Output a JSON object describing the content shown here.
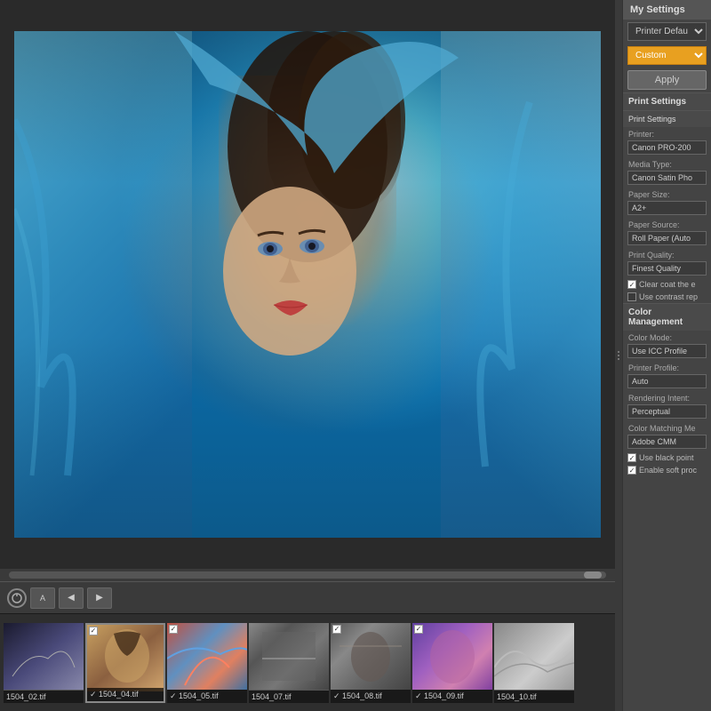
{
  "panel": {
    "my_settings_label": "My Settings",
    "printer_default_label": "Printer Default",
    "custom_label": "Custom",
    "apply_label": "Apply",
    "print_settings_header": "Print Settings",
    "print_settings_sub": "Print Settings",
    "printer_field_label": "Printer:",
    "printer_field_value": "Canon PRO-200",
    "media_type_label": "Media Type:",
    "media_type_value": "Canon Satin Pho",
    "paper_size_label": "Paper Size:",
    "paper_size_value": "A2+",
    "paper_source_label": "Paper Source:",
    "paper_source_value": "Roll Paper (Auto",
    "print_quality_label": "Print Quality:",
    "print_quality_value": "Finest Quality",
    "clear_coat_label": "Clear coat the e",
    "use_contrast_label": "Use contrast rep",
    "color_management_label": "Color Management",
    "color_mode_label": "Color Mode:",
    "color_mode_value": "Use ICC Profile",
    "printer_profile_label": "Printer Profile:",
    "printer_profile_value": "Auto",
    "rendering_intent_label": "Rendering Intent:",
    "rendering_intent_value": "Perceptual",
    "color_matching_label": "Color Matching Me",
    "color_matching_value": "Adobe CMM",
    "use_black_point_label": "Use black point",
    "enable_soft_label": "Enable soft proc"
  },
  "filmstrip": {
    "items": [
      {
        "filename": "1504_02.tif",
        "checked": false
      },
      {
        "filename": "1504_04.tif",
        "checked": true
      },
      {
        "filename": "1504_05.tif",
        "checked": true
      },
      {
        "filename": "1504_07.tif",
        "checked": false
      },
      {
        "filename": "1504_08.tif",
        "checked": true
      },
      {
        "filename": "1504_09.tif",
        "checked": true
      },
      {
        "filename": "1504_10.tif",
        "checked": false
      }
    ]
  },
  "toolbar": {
    "rotate_label": "⟳",
    "back_label": "◀",
    "forward_label": "▶"
  }
}
